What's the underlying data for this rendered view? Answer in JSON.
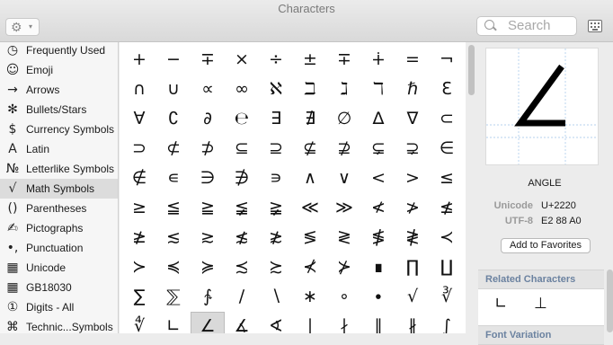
{
  "window": {
    "title": "Characters"
  },
  "toolbar": {
    "gear_icon": "gear-icon",
    "search_placeholder": "Search"
  },
  "sidebar": {
    "items": [
      {
        "label": "Frequently Used",
        "icon": "◷"
      },
      {
        "label": "Emoji",
        "icon": "☺"
      },
      {
        "label": "Arrows",
        "icon": "→"
      },
      {
        "label": "Bullets/Stars",
        "icon": "✻"
      },
      {
        "label": "Currency Symbols",
        "icon": "$"
      },
      {
        "label": "Latin",
        "icon": "A"
      },
      {
        "label": "Letterlike Symbols",
        "icon": "№"
      },
      {
        "label": "Math Symbols",
        "icon": "√",
        "selected": true
      },
      {
        "label": "Parentheses",
        "icon": "()"
      },
      {
        "label": "Pictographs",
        "icon": "✍"
      },
      {
        "label": "Punctuation",
        "icon": "•,"
      },
      {
        "label": "Unicode",
        "icon": "▦"
      },
      {
        "label": "GB18030",
        "icon": "▦"
      },
      {
        "label": "Digits - All",
        "icon": "①"
      },
      {
        "label": "Technic...Symbols",
        "icon": "⌘"
      }
    ]
  },
  "grid": {
    "rows": [
      [
        "+",
        "−",
        "∓",
        "×",
        "÷",
        "±",
        "∓",
        "∔",
        "=",
        "¬"
      ],
      [
        "∩",
        "∪",
        "∝",
        "∞",
        "ℵ",
        "ℶ",
        "ℷ",
        "ℸ",
        "ℏ",
        "ℇ"
      ],
      [
        "∀",
        "∁",
        "∂",
        "℮",
        "∃",
        "∄",
        "∅",
        "∆",
        "∇",
        "⊂"
      ],
      [
        "⊃",
        "⊄",
        "⊅",
        "⊆",
        "⊇",
        "⊈",
        "⊉",
        "⊊",
        "⊋",
        "∈"
      ],
      [
        "∉",
        "∊",
        "∋",
        "∌",
        "∍",
        "∧",
        "∨",
        "<",
        ">",
        "≤"
      ],
      [
        "≥",
        "≦",
        "≧",
        "≨",
        "≩",
        "≪",
        "≫",
        "≮",
        "≯",
        "≰"
      ],
      [
        "≱",
        "≲",
        "≳",
        "≴",
        "≵",
        "≶",
        "≷",
        "≸",
        "≹",
        "≺"
      ],
      [
        "≻",
        "≼",
        "≽",
        "≾",
        "≿",
        "⊀",
        "⊁",
        "∎",
        "∏",
        "∐"
      ],
      [
        "∑",
        "⅀",
        "∱",
        "∕",
        "∖",
        "∗",
        "∘",
        "∙",
        "√",
        "∛"
      ],
      [
        "∜",
        "∟",
        "∠",
        "∡",
        "∢",
        "∣",
        "∤",
        "∥",
        "∦",
        "∫"
      ]
    ],
    "selected_row": 9,
    "selected_col": 2
  },
  "detail": {
    "preview_char": "∠",
    "name": "ANGLE",
    "unicode_label": "Unicode",
    "unicode_value": "U+2220",
    "utf8_label": "UTF-8",
    "utf8_value": "E2 88 A0",
    "add_favorites_label": "Add to Favorites",
    "related_header": "Related Characters",
    "related_chars": [
      "∟",
      "⊥"
    ],
    "font_variation_header": "Font Variation"
  }
}
